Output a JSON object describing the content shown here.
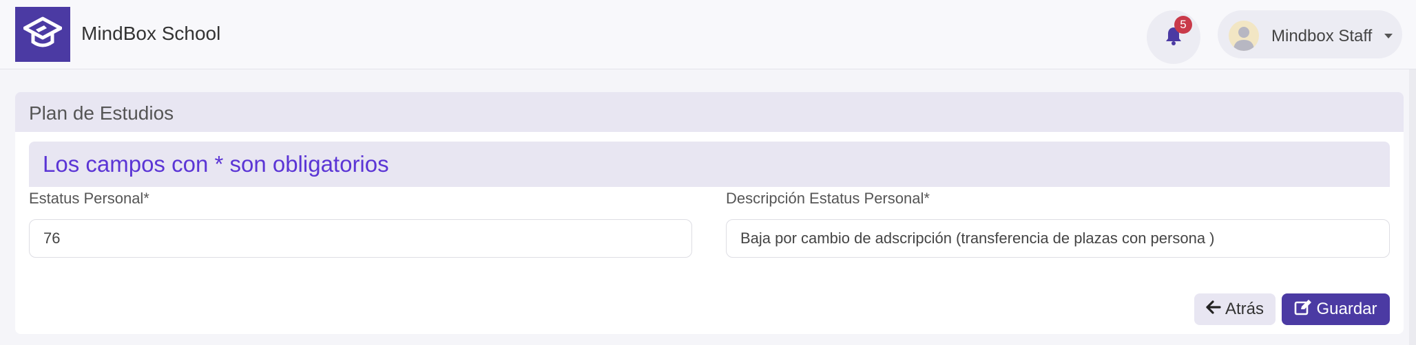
{
  "app": {
    "title": "MindBox School",
    "logo_icon": "graduation-cap-icon",
    "brand_color": "#4b3aa3"
  },
  "header": {
    "notifications": {
      "icon": "bell-icon",
      "count": "5"
    },
    "user": {
      "name": "Mindbox Staff",
      "avatar_icon": "user-avatar-icon",
      "menu_icon": "caret-down-icon"
    }
  },
  "card": {
    "title": "Plan de Estudios",
    "notice": "Los campos con * son obligatorios",
    "fields": [
      {
        "label": "Estatus Personal*",
        "value": "76"
      },
      {
        "label": "Descripción Estatus Personal*",
        "value": "Baja por cambio de adscripción (transferencia de plazas con persona )"
      }
    ],
    "buttons": {
      "back": {
        "label": "Atrás",
        "icon": "arrow-left-icon"
      },
      "save": {
        "label": "Guardar",
        "icon": "edit-icon"
      }
    }
  },
  "colors": {
    "accent_text": "#5b35d5",
    "badge": "#c93a4a",
    "header_bg": "#e8e6f2"
  }
}
